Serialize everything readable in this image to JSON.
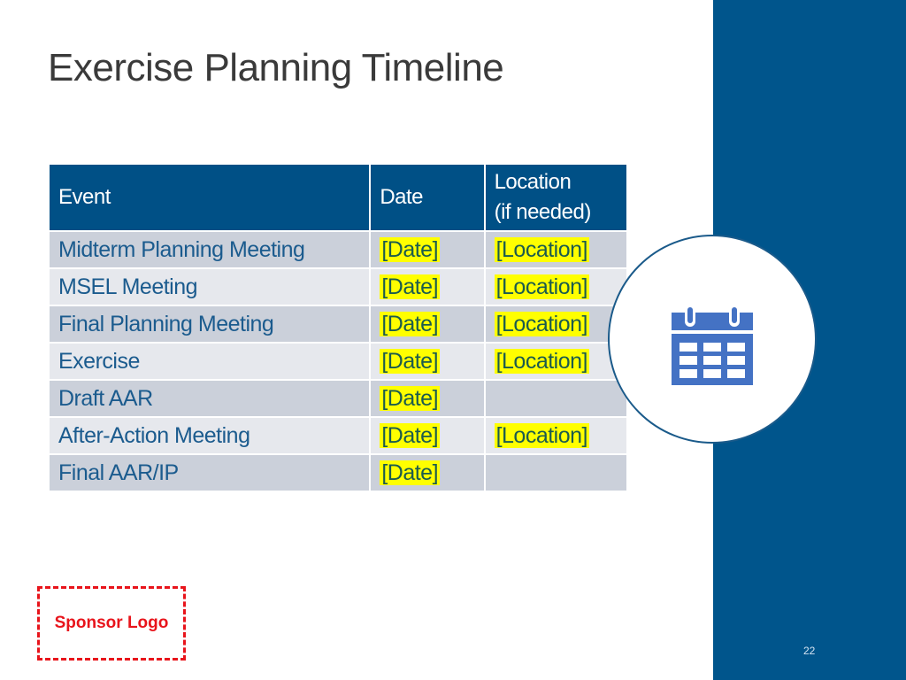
{
  "slide": {
    "title": "Exercise Planning Timeline",
    "page_number": "22",
    "sponsor_placeholder": "Sponsor Logo",
    "icon": "calendar-icon"
  },
  "table": {
    "headers": [
      "Event",
      "Date",
      "Location\n(if needed)"
    ],
    "header_location_line1": "Location",
    "header_location_line2": "(if needed)",
    "rows": [
      {
        "event": "Midterm Planning Meeting",
        "date": "[Date]",
        "location": "[Location]"
      },
      {
        "event": "MSEL Meeting",
        "date": "[Date]",
        "location": "[Location]"
      },
      {
        "event": "Final Planning Meeting",
        "date": "[Date]",
        "location": "[Location]"
      },
      {
        "event": "Exercise",
        "date": "[Date]",
        "location": "[Location]"
      },
      {
        "event": "Draft AAR",
        "date": "[Date]",
        "location": ""
      },
      {
        "event": "After-Action Meeting",
        "date": "[Date]",
        "location": "[Location]"
      },
      {
        "event": "Final AAR/IP",
        "date": "[Date]",
        "location": ""
      }
    ]
  },
  "colors": {
    "brand_blue": "#00558c",
    "header_blue": "#005086",
    "row_dark": "#cbd0da",
    "row_light": "#e6e8ed",
    "highlight": "#ffff00",
    "icon_blue": "#4472c4",
    "sponsor_red": "#e8141b"
  }
}
